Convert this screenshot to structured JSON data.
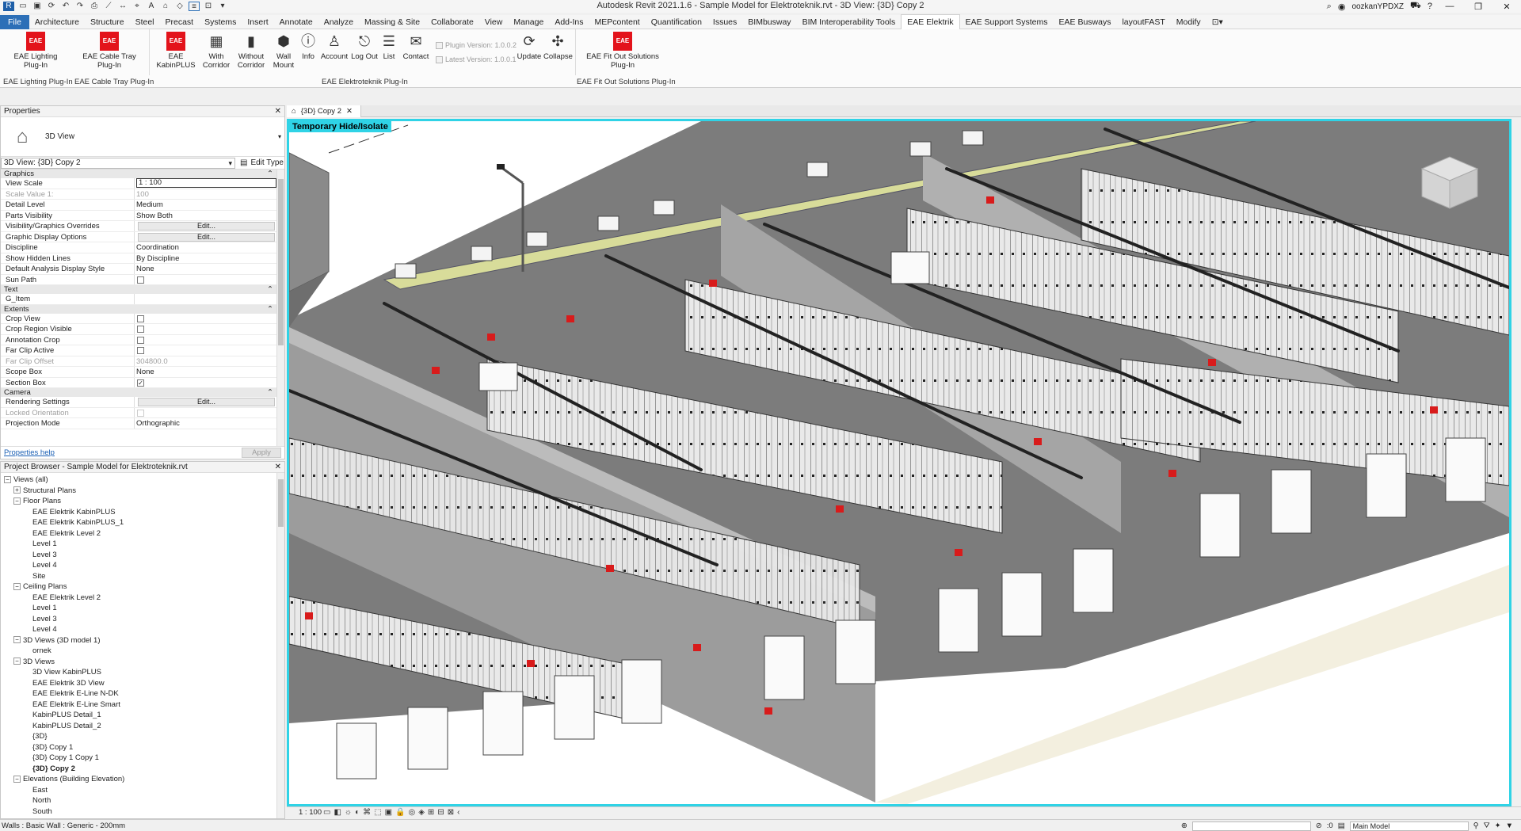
{
  "titlebar": {
    "title": "Autodesk Revit 2021.1.6 - Sample Model for Elektroteknik.rvt - 3D View: {3D} Copy 2",
    "user": "oozkanYPDXZ",
    "qat_icons": [
      "revit-logo-icon",
      "open-icon",
      "save-icon",
      "sync-icon",
      "undo-icon",
      "redo-icon",
      "print-icon",
      "measure-icon",
      "dimension-icon",
      "tag-icon",
      "text-icon",
      "3d-view-icon",
      "section-icon",
      "thin-lines-icon",
      "close-hidden-icon",
      "switch-windows-icon"
    ]
  },
  "ribbon_tabs": [
    "File",
    "Architecture",
    "Structure",
    "Steel",
    "Precast",
    "Systems",
    "Insert",
    "Annotate",
    "Analyze",
    "Massing & Site",
    "Collaborate",
    "View",
    "Manage",
    "Add-Ins",
    "MEPcontent",
    "Quantification",
    "Issues",
    "BIMbusway",
    "BIM Interoperability Tools",
    "EAE Elektrik",
    "EAE Support Systems",
    "EAE Busways",
    "layoutFAST",
    "Modify"
  ],
  "active_tab": "EAE Elektrik",
  "ribbon": {
    "logo_text": "EAE",
    "buttons": {
      "lighting": "EAE Lighting\nPlug-In",
      "cabletray": "EAE Cable Tray\nPlug-In",
      "kabinplus": "EAE KabinPLUS",
      "with_corridor": "With\nCorridor",
      "without_corridor": "Without\nCorridor",
      "wall_mount": "Wall\nMount",
      "info": "Info",
      "account": "Account",
      "logout": "Log Out",
      "list": "List",
      "contact": "Contact",
      "update": "Update",
      "collapse": "Collapse",
      "fitout": "EAE Fit Out Solutions\nPlug-In"
    },
    "plugin_version": "Plugin Version: 1.0.0.2",
    "latest_version": "Latest Version: 1.0.0.1",
    "panels": [
      "EAE Lighting Plug-In",
      "EAE Cable Tray Plug-In",
      "EAE Elektroteknik Plug-In",
      "EAE Fit Out Solutions Plug-In"
    ]
  },
  "properties": {
    "title": "Properties",
    "type_name": "3D View",
    "view_selector": "3D View: {3D} Copy 2",
    "edit_type": "Edit Type",
    "groups": {
      "graphics": "Graphics",
      "text": "Text",
      "extents": "Extents",
      "camera": "Camera"
    },
    "rows": {
      "view_scale": [
        "View Scale",
        "1 : 100"
      ],
      "scale_value": [
        "Scale Value    1:",
        "100"
      ],
      "detail_level": [
        "Detail Level",
        "Medium"
      ],
      "parts_visibility": [
        "Parts Visibility",
        "Show Both"
      ],
      "vg_overrides": [
        "Visibility/Graphics Overrides",
        "Edit..."
      ],
      "graphic_display": [
        "Graphic Display Options",
        "Edit..."
      ],
      "discipline": [
        "Discipline",
        "Coordination"
      ],
      "hidden_lines": [
        "Show Hidden Lines",
        "By Discipline"
      ],
      "analysis_style": [
        "Default Analysis Display Style",
        "None"
      ],
      "sun_path": [
        "Sun Path",
        ""
      ],
      "g_item": [
        "G_Item",
        ""
      ],
      "crop_view": [
        "Crop View",
        ""
      ],
      "crop_region": [
        "Crop Region Visible",
        ""
      ],
      "annotation_crop": [
        "Annotation Crop",
        ""
      ],
      "far_clip_active": [
        "Far Clip Active",
        ""
      ],
      "far_clip_offset": [
        "Far Clip Offset",
        "304800.0"
      ],
      "scope_box": [
        "Scope Box",
        "None"
      ],
      "section_box": [
        "Section Box",
        "✓"
      ],
      "rendering": [
        "Rendering Settings",
        "Edit..."
      ],
      "locked_orientation": [
        "Locked Orientation",
        ""
      ],
      "projection_mode": [
        "Projection Mode",
        "Orthographic"
      ]
    },
    "help_link": "Properties help",
    "apply": "Apply"
  },
  "browser": {
    "title": "Project Browser - Sample Model for Elektroteknik.rvt",
    "tree": [
      {
        "label": "Views (all)",
        "level": 0,
        "exp": "−"
      },
      {
        "label": "Structural Plans",
        "level": 1,
        "exp": "+"
      },
      {
        "label": "Floor Plans",
        "level": 1,
        "exp": "−"
      },
      {
        "label": "EAE Elektrik KabinPLUS",
        "level": 2
      },
      {
        "label": "EAE Elektrik KabinPLUS_1",
        "level": 2
      },
      {
        "label": "EAE Elektrik Level 2",
        "level": 2
      },
      {
        "label": "Level 1",
        "level": 2
      },
      {
        "label": "Level 3",
        "level": 2
      },
      {
        "label": "Level 4",
        "level": 2
      },
      {
        "label": "Site",
        "level": 2
      },
      {
        "label": "Ceiling Plans",
        "level": 1,
        "exp": "−"
      },
      {
        "label": "EAE Elektrik Level 2",
        "level": 2
      },
      {
        "label": "Level 1",
        "level": 2
      },
      {
        "label": "Level 3",
        "level": 2
      },
      {
        "label": "Level 4",
        "level": 2
      },
      {
        "label": "3D Views (3D model 1)",
        "level": 1,
        "exp": "−"
      },
      {
        "label": "ornek",
        "level": 2
      },
      {
        "label": "3D Views",
        "level": 1,
        "exp": "−"
      },
      {
        "label": "3D View KabinPLUS",
        "level": 2
      },
      {
        "label": "EAE Elektrik 3D View",
        "level": 2
      },
      {
        "label": "EAE Elektrik E-Line N-DK",
        "level": 2
      },
      {
        "label": "EAE Elektrik E-Line Smart",
        "level": 2
      },
      {
        "label": "KabinPLUS Detail_1",
        "level": 2
      },
      {
        "label": "KabinPLUS Detail_2",
        "level": 2
      },
      {
        "label": "{3D}",
        "level": 2
      },
      {
        "label": "{3D} Copy 1",
        "level": 2
      },
      {
        "label": "{3D} Copy 1 Copy 1",
        "level": 2
      },
      {
        "label": "{3D} Copy 2",
        "level": 2,
        "bold": true
      },
      {
        "label": "Elevations (Building Elevation)",
        "level": 1,
        "exp": "−"
      },
      {
        "label": "East",
        "level": 2
      },
      {
        "label": "North",
        "level": 2
      },
      {
        "label": "South",
        "level": 2
      }
    ]
  },
  "view": {
    "tab_label": "{3D} Copy 2",
    "hide_isolate": "Temporary Hide/Isolate",
    "scale": "1 : 100"
  },
  "status": {
    "text": "Walls : Basic Wall : Generic - 200mm",
    "workset": "Main Model",
    "selection_count": ":0"
  },
  "colors": {
    "accent": "#2c6fb7",
    "brand_red": "#e3131b",
    "isolate_cyan": "#2fd3e6"
  }
}
